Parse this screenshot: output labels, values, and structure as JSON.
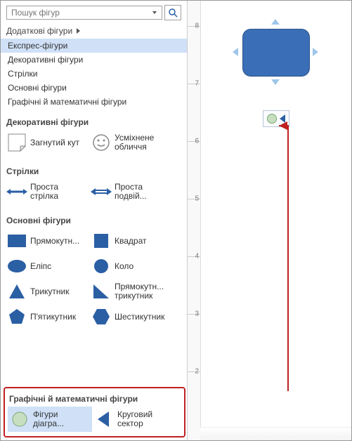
{
  "search": {
    "placeholder": "Пошук фігур"
  },
  "more_shapes": "Додаткові фігури",
  "categories": [
    "Експрес-фігури",
    "Декоративні фігури",
    "Стрілки",
    "Основні фігури",
    "Графічні й математичні фігури"
  ],
  "sections": {
    "decorative": {
      "title": "Декоративні фігури",
      "items": [
        "Загнутий кут",
        "Усміхнене обличчя"
      ]
    },
    "arrows": {
      "title": "Стрілки",
      "items": [
        "Проста стрілка",
        "Проста подвій..."
      ]
    },
    "basic": {
      "title": "Основні фігури",
      "items": [
        "Прямокутн...",
        "Квадрат",
        "Еліпс",
        "Коло",
        "Трикутник",
        "Прямокутн... трикутник",
        "П'ятикутник",
        "Шестикутник"
      ]
    },
    "math": {
      "title": "Графічні й математичні фігури",
      "items": [
        "Фігури діагра...",
        "Круговий сектор"
      ]
    }
  },
  "ruler_ticks": [
    "8",
    "7",
    "6",
    "5",
    "4",
    "3",
    "2"
  ],
  "colors": {
    "shape_fill": "#3a6fb7",
    "callout": "#c02020"
  }
}
